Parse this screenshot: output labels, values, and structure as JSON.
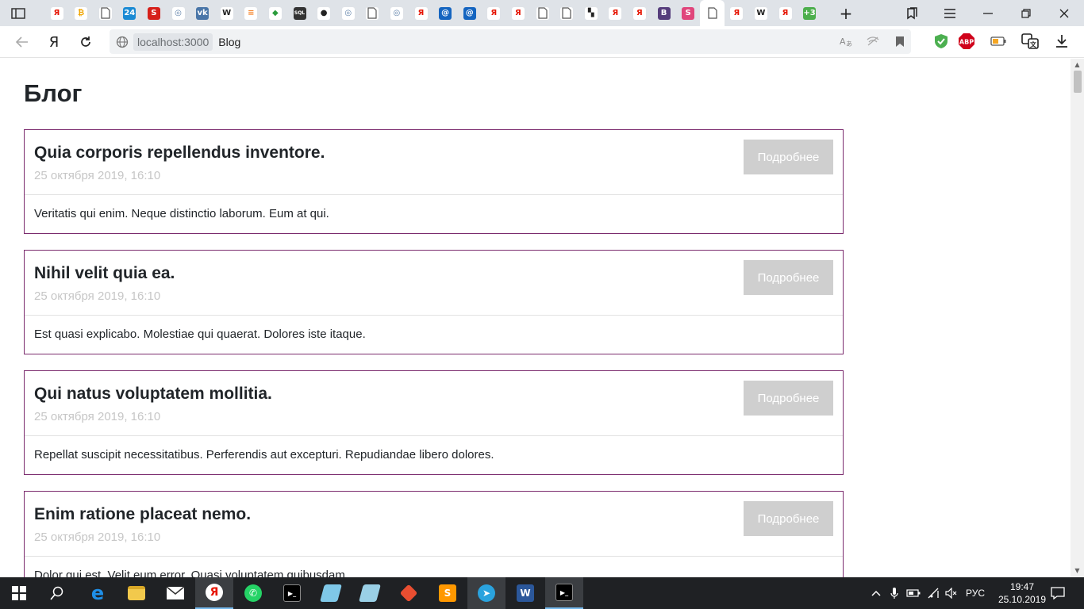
{
  "browser": {
    "tabs": [
      {
        "icon": "yandex-icon",
        "glyph": "Я",
        "color": "#e61400",
        "bg": "#ffffff"
      },
      {
        "icon": "coin-icon",
        "glyph": "₿",
        "color": "#f0a500",
        "bg": "#ffffff"
      },
      {
        "icon": "page-icon",
        "glyph": "",
        "color": "#555555",
        "bg": "#ffffff"
      },
      {
        "icon": "24-icon",
        "glyph": "24",
        "color": "#ffffff",
        "bg": "#1a8ad4"
      },
      {
        "icon": "s-icon",
        "glyph": "S",
        "color": "#ffffff",
        "bg": "#d6201a"
      },
      {
        "icon": "globe-icon",
        "glyph": "◎",
        "color": "#5c7fa8",
        "bg": "#ffffff"
      },
      {
        "icon": "vk-icon",
        "glyph": "vk",
        "color": "#ffffff",
        "bg": "#4a76a8"
      },
      {
        "icon": "wikipedia-icon",
        "glyph": "W",
        "color": "#222222",
        "bg": "#ffffff"
      },
      {
        "icon": "stackoverflow-icon",
        "glyph": "≡",
        "color": "#f48024",
        "bg": "#ffffff"
      },
      {
        "icon": "rainbow-icon",
        "glyph": "◆",
        "color": "#2b9c3c",
        "bg": "#ffffff"
      },
      {
        "icon": "sql-icon",
        "glyph": "SQL",
        "color": "#ffffff",
        "bg": "#333333"
      },
      {
        "icon": "github-icon",
        "glyph": "●",
        "color": "#222222",
        "bg": "#ffffff"
      },
      {
        "icon": "globe-icon",
        "glyph": "◎",
        "color": "#5c7fa8",
        "bg": "#ffffff"
      },
      {
        "icon": "page-icon",
        "glyph": "",
        "color": "#555555",
        "bg": "#ffffff"
      },
      {
        "icon": "globe-icon",
        "glyph": "◎",
        "color": "#5c7fa8",
        "bg": "#ffffff"
      },
      {
        "icon": "yandex-icon",
        "glyph": "Я",
        "color": "#e61400",
        "bg": "#ffffff"
      },
      {
        "icon": "mail-icon",
        "glyph": "@",
        "color": "#ffffff",
        "bg": "#1565c0"
      },
      {
        "icon": "mail-icon",
        "glyph": "@",
        "color": "#ffffff",
        "bg": "#1565c0"
      },
      {
        "icon": "yandex-icon",
        "glyph": "Я",
        "color": "#e61400",
        "bg": "#ffffff"
      },
      {
        "icon": "yandex-icon",
        "glyph": "Я",
        "color": "#e61400",
        "bg": "#ffffff"
      },
      {
        "icon": "page-icon",
        "glyph": "",
        "color": "#555555",
        "bg": "#ffffff"
      },
      {
        "icon": "page-icon",
        "glyph": "",
        "color": "#555555",
        "bg": "#ffffff"
      },
      {
        "icon": "chat-icon",
        "glyph": "▚",
        "color": "#222222",
        "bg": "#ffffff"
      },
      {
        "icon": "yandex-icon",
        "glyph": "Я",
        "color": "#e61400",
        "bg": "#ffffff"
      },
      {
        "icon": "yandex-icon",
        "glyph": "Я",
        "color": "#e61400",
        "bg": "#ffffff"
      },
      {
        "icon": "bootstrap-icon",
        "glyph": "B",
        "color": "#ffffff",
        "bg": "#563d7c"
      },
      {
        "icon": "swatch-icon",
        "glyph": "S",
        "color": "#ffffff",
        "bg": "#e0457b"
      },
      {
        "icon": "page-icon",
        "glyph": "",
        "color": "#555555",
        "bg": "#ffffff",
        "active": true
      },
      {
        "icon": "yandex-translate-icon",
        "glyph": "Я",
        "color": "#e61400",
        "bg": "#ffffff"
      },
      {
        "icon": "zigzag-icon",
        "glyph": "W",
        "color": "#222222",
        "bg": "#ffffff"
      },
      {
        "icon": "yandex-icon",
        "glyph": "Я",
        "color": "#e61400",
        "bg": "#ffffff"
      },
      {
        "icon": "counter-icon",
        "glyph": "+3",
        "color": "#ffffff",
        "bg": "#4cae4c"
      }
    ],
    "new_tab_label": "+",
    "url_host": "localhost:3000",
    "url_title": "Blog",
    "yandex_button": "Я"
  },
  "page": {
    "title": "Блог",
    "read_more_label": "Подробнее",
    "posts": [
      {
        "title": "Quia corporis repellendus inventore.",
        "date": "25 октября 2019, 16:10",
        "excerpt": "Veritatis qui enim. Neque distinctio laborum. Eum at qui."
      },
      {
        "title": "Nihil velit quia ea.",
        "date": "25 октября 2019, 16:10",
        "excerpt": "Est quasi explicabo. Molestiae qui quaerat. Dolores iste itaque."
      },
      {
        "title": "Qui natus voluptatem mollitia.",
        "date": "25 октября 2019, 16:10",
        "excerpt": "Repellat suscipit necessitatibus. Perferendis aut excepturi. Repudiandae libero dolores."
      },
      {
        "title": "Enim ratione placeat nemo.",
        "date": "25 октября 2019, 16:10",
        "excerpt": "Dolor qui est. Velit eum error. Quasi voluptatem quibusdam."
      }
    ],
    "accent_color": "#7b2b6e"
  },
  "taskbar": {
    "lang": "РУС",
    "time": "19:47",
    "date": "25.10.2019"
  }
}
